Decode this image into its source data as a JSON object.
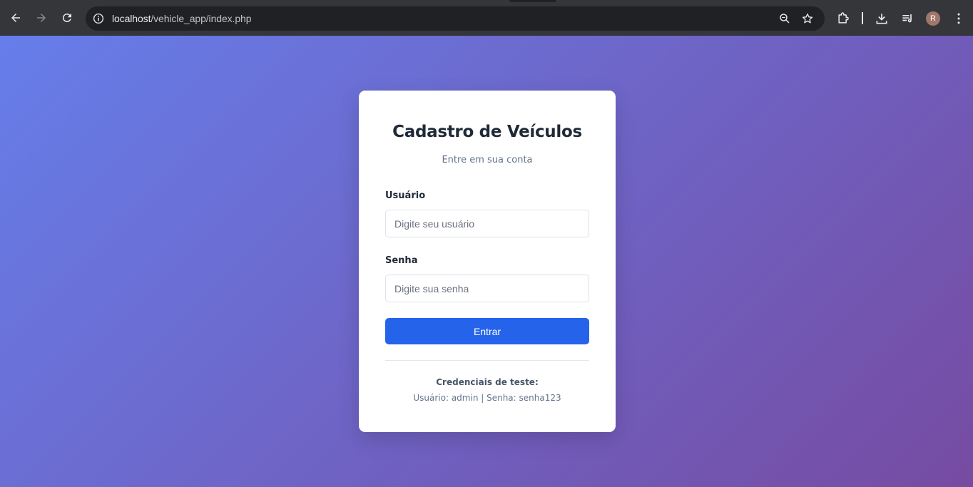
{
  "browser": {
    "url_host": "localhost",
    "url_path": "/vehicle_app/index.php",
    "avatar_letter": "R"
  },
  "login": {
    "title": "Cadastro de Veículos",
    "subtitle": "Entre em sua conta",
    "username_label": "Usuário",
    "username_placeholder": "Digite seu usuário",
    "password_label": "Senha",
    "password_placeholder": "Digite sua senha",
    "submit_label": "Entrar",
    "credentials_title": "Credenciais de teste:",
    "credentials_text": "Usuário: admin | Senha: senha123"
  },
  "colors": {
    "gradient_start": "#667eea",
    "gradient_end": "#764ba2",
    "button": "#2563eb"
  }
}
